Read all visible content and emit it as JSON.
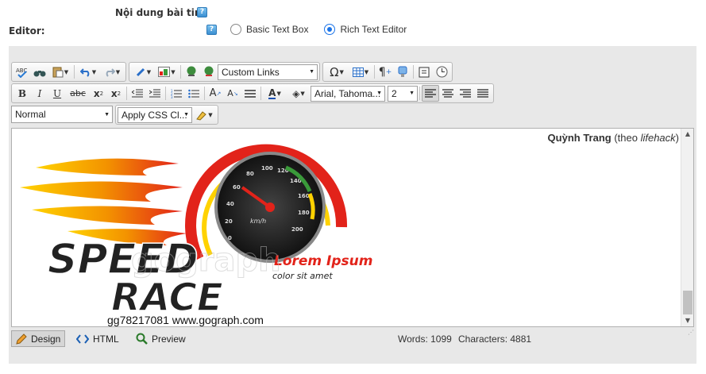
{
  "form": {
    "content_label": "Nội dung bài tin:",
    "editor_label": "Editor:",
    "help_glyph": "?",
    "editor_options": [
      {
        "label": "Basic Text Box",
        "selected": false
      },
      {
        "label": "Rich Text Editor",
        "selected": true
      }
    ]
  },
  "toolbar": {
    "custom_links": "Custom Links",
    "font_family": "Arial, Tahoma...",
    "font_size": "2",
    "paragraph_style": "Normal",
    "css_class": "Apply CSS Cl...",
    "icons_row1": [
      "spellcheck-icon",
      "find-replace-icon",
      "paste-icon",
      "undo-icon",
      "redo-icon",
      "link-tool-icon",
      "image-manager-icon",
      "hyperlink-icon",
      "unlink-icon",
      "symbol-icon",
      "table-icon",
      "paragraph-mark-icon",
      "template-icon",
      "print-icon",
      "time-icon"
    ],
    "icons_row2": [
      "bold-icon",
      "italic-icon",
      "underline-icon",
      "strikethrough-icon",
      "superscript-icon",
      "subscript-icon",
      "outdent-icon",
      "indent-icon",
      "numbered-list-icon",
      "bulleted-list-icon",
      "font-size-increase-icon",
      "font-size-decrease-icon",
      "horizontal-rule-icon",
      "font-color-icon",
      "highlight-icon",
      "align-left-icon",
      "align-center-icon",
      "align-right-icon",
      "justify-icon"
    ]
  },
  "content": {
    "author": "Quỳnh Trang",
    "source_prefix": " (theo ",
    "source": "lifehack",
    "source_suffix": ")",
    "logo": {
      "line1": "SPEED",
      "line2": "RACE",
      "tagline1": "Lorem Ipsum",
      "tagline2": "color sit amet",
      "watermark": "gograph",
      "speedometer_ticks": [
        "0",
        "20",
        "40",
        "60",
        "80",
        "100",
        "120",
        "140",
        "160",
        "180",
        "200"
      ],
      "speedometer_unit": "km/h"
    },
    "caption": "gg78217081   www.gograph.com"
  },
  "bottom": {
    "modes": [
      {
        "label": "Design",
        "icon": "pencil-icon",
        "active": true
      },
      {
        "label": "HTML",
        "icon": "code-brackets-icon",
        "active": false
      },
      {
        "label": "Preview",
        "icon": "magnifier-icon",
        "active": false
      }
    ],
    "words": "Words: 1099",
    "characters": "Characters: 4881"
  },
  "colors": {
    "accent": "#1a73e8",
    "logo_red": "#e2231a",
    "logo_orange": "#f39200",
    "logo_yellow": "#ffd200"
  }
}
